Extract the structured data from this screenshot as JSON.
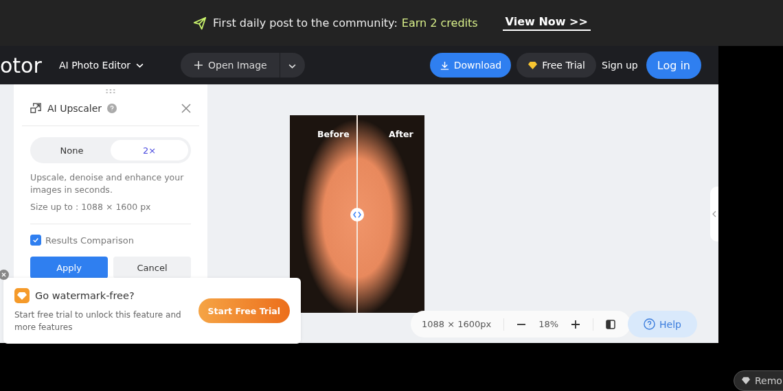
{
  "banner": {
    "message": "First daily post to the community:",
    "reward": "Earn 2 credits",
    "link": "View Now >>"
  },
  "nav": {
    "logo": "otor",
    "menu": "AI Photo Editor",
    "open_image": "Open Image",
    "download": "Download",
    "free_trial": "Free Trial",
    "sign_up": "Sign up",
    "log_in": "Log in"
  },
  "panel": {
    "title": "AI Upscaler",
    "options": [
      {
        "label": "None",
        "selected": false
      },
      {
        "label": "2×",
        "selected": true
      }
    ],
    "description": "Upscale, denoise and enhance your images in seconds.",
    "size": "Size up to : 1088 × 1600 px",
    "comparison": {
      "label": "Results Comparison",
      "checked": true
    },
    "apply": "Apply",
    "cancel": "Cancel"
  },
  "preview": {
    "before": "Before",
    "after": "After"
  },
  "promo": {
    "title": "Go watermark-free?",
    "text": "Start free trial to unlock this feature and more features",
    "button": "Start Free Trial"
  },
  "zoom_bar": {
    "dimensions": "1088 × 1600px",
    "zoom": "18%",
    "help": "Help"
  },
  "corner_button": "Remo"
}
